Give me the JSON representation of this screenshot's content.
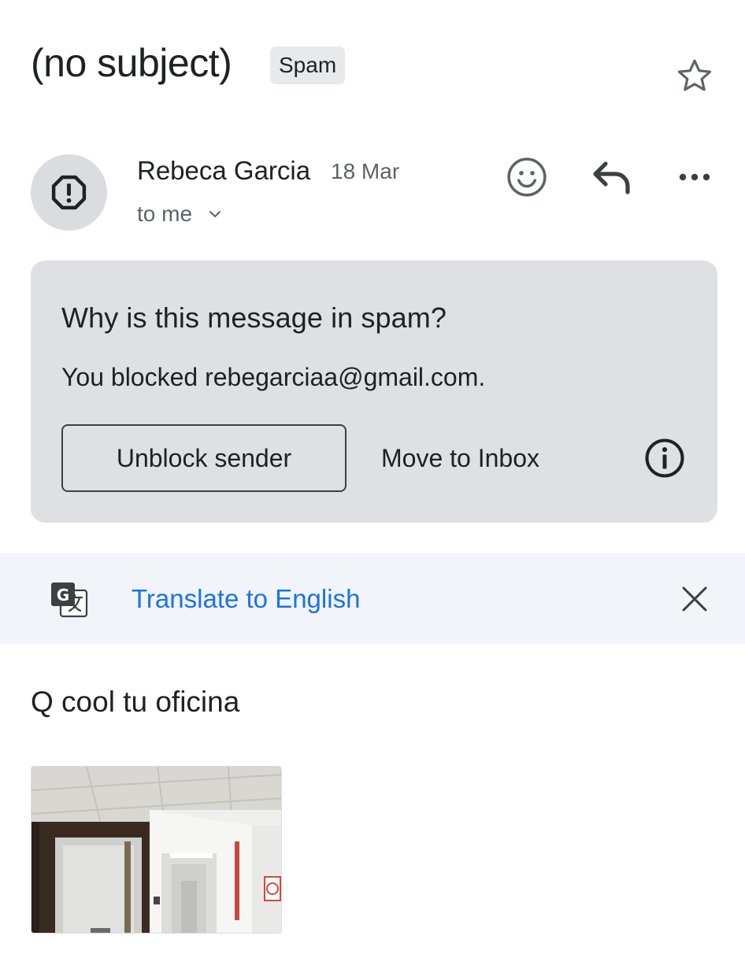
{
  "header": {
    "subject": "(no subject)",
    "label": "Spam"
  },
  "message": {
    "sender_name": "Rebeca Garcia",
    "date": "18 Mar",
    "recipient": "to me"
  },
  "spam_notice": {
    "title": "Why is this message in spam?",
    "reason": "You blocked rebegarciaa@gmail.com.",
    "unblock_label": "Unblock sender",
    "move_label": "Move to Inbox"
  },
  "translate": {
    "link_label": "Translate to English"
  },
  "body": {
    "text": "Q cool tu oficina"
  },
  "icons": {
    "star": "star-outline-icon",
    "avatar": "spam-warning-icon",
    "emoji": "emoji-reaction-icon",
    "reply": "reply-icon",
    "more": "more-horizontal-icon",
    "info": "info-icon",
    "translate": "google-translate-icon",
    "close": "close-icon"
  },
  "colors": {
    "link": "#1a73e8",
    "card_bg": "#dfe0e3",
    "translate_bg": "#f1f4f9",
    "secondary_text": "#5f6368"
  }
}
